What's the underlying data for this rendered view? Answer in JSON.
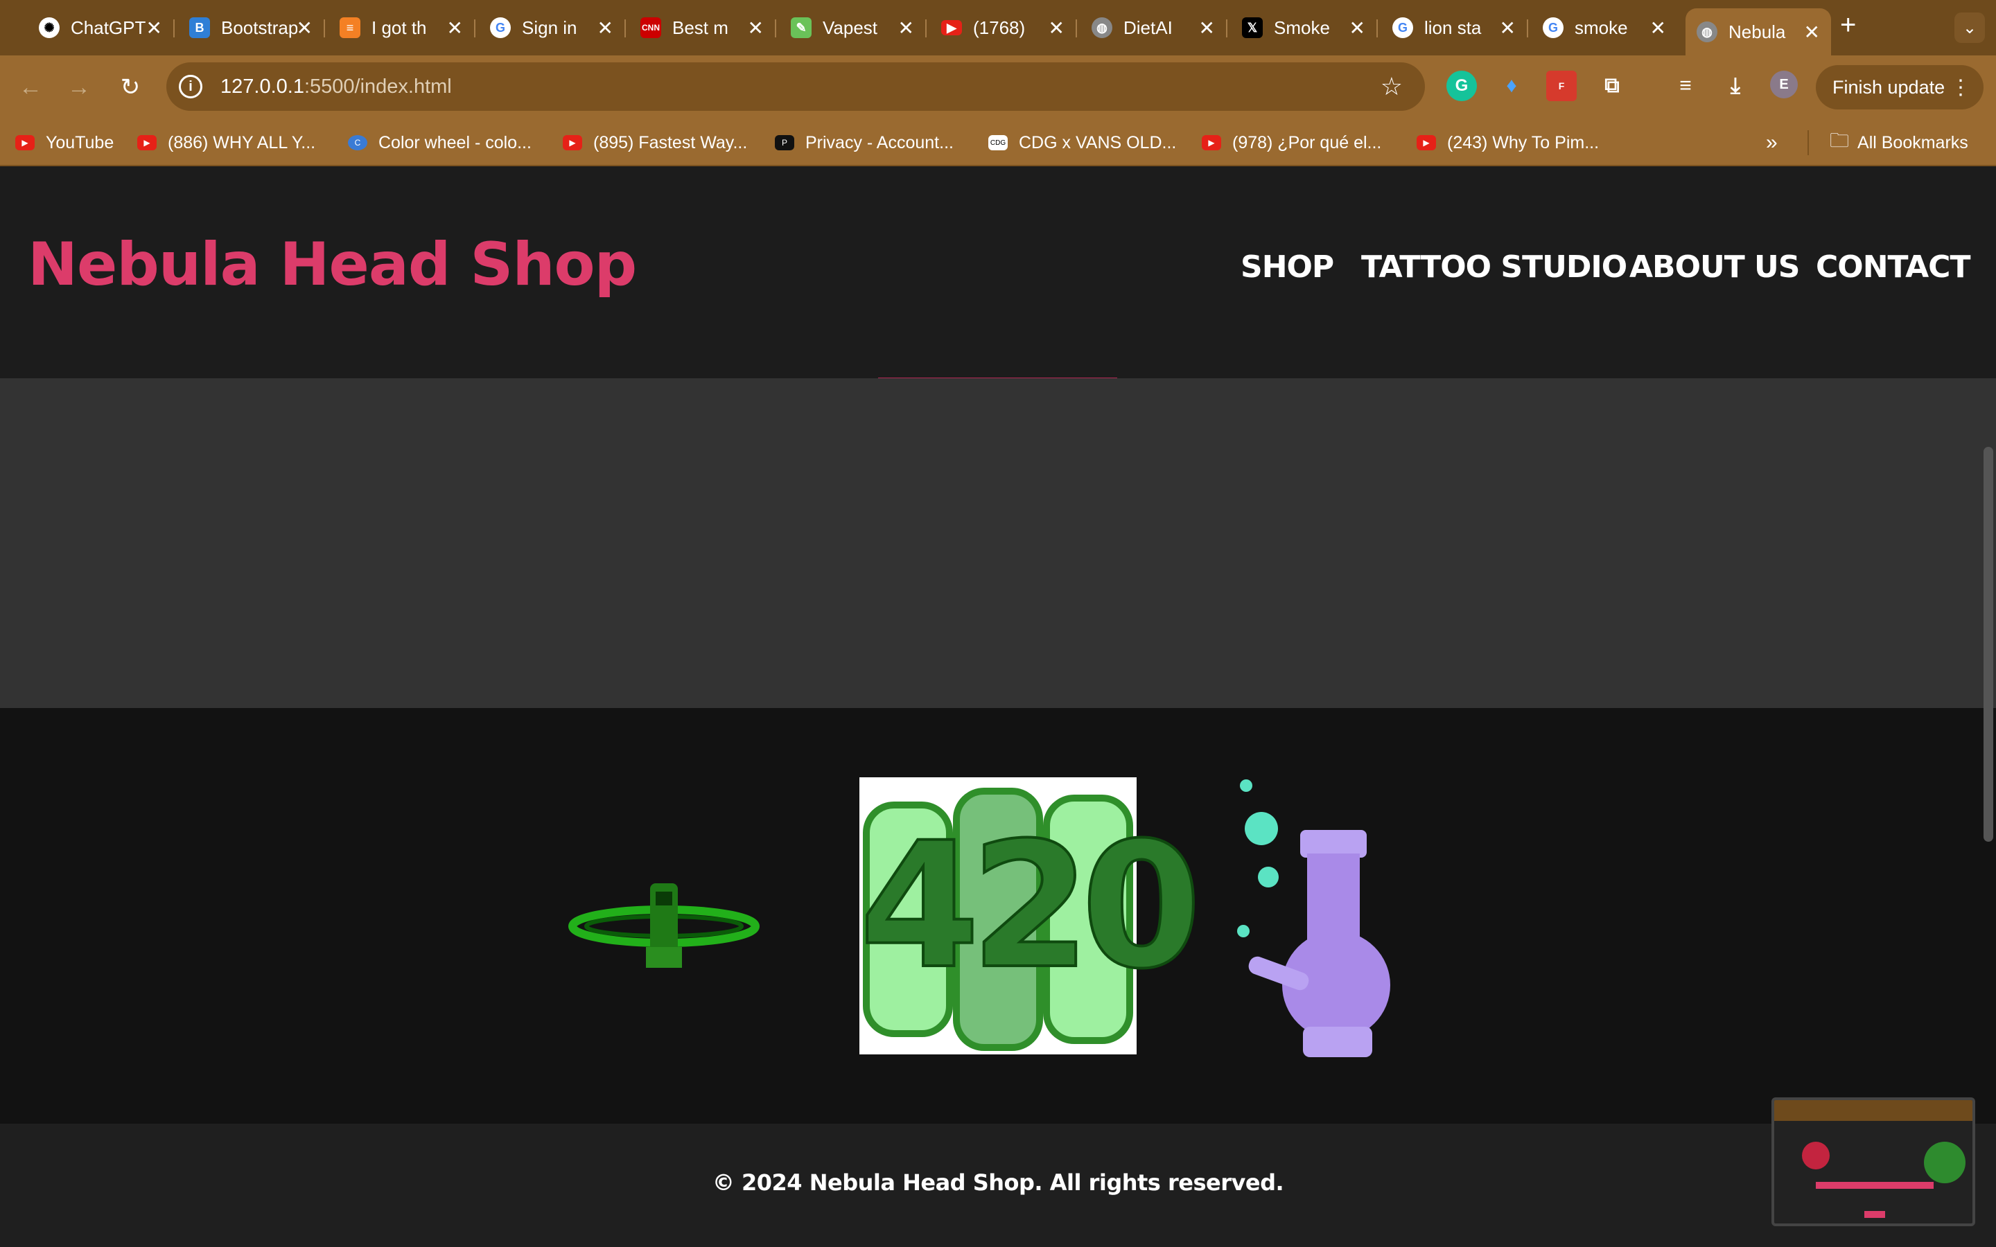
{
  "browser": {
    "tabs": [
      {
        "title": "ChatGPT",
        "icon": "chatgpt-icon"
      },
      {
        "title": "Bootstrap",
        "icon": "bootstrap-icon"
      },
      {
        "title": "I got th",
        "icon": "stackoverflow-icon"
      },
      {
        "title": "Sign in",
        "icon": "google-icon"
      },
      {
        "title": "Best m",
        "icon": "cnn-icon"
      },
      {
        "title": "Vapest",
        "icon": "vapestore-icon"
      },
      {
        "title": "(1768)",
        "icon": "youtube-icon"
      },
      {
        "title": "DietAI",
        "icon": "globe-icon"
      },
      {
        "title": "Smoke",
        "icon": "x-icon"
      },
      {
        "title": "lion sta",
        "icon": "google-icon"
      },
      {
        "title": "smoke",
        "icon": "google-icon"
      },
      {
        "title": "Nebula",
        "icon": "globe-icon"
      }
    ],
    "url_host": "127.0.0.1",
    "url_rest": ":5500/index.html",
    "finish_update": "Finish update",
    "profile_initial": "E",
    "bookmarks": [
      {
        "label": "YouTube"
      },
      {
        "label": "(886) WHY ALL Y..."
      },
      {
        "label": "Color wheel - colo..."
      },
      {
        "label": "(895) Fastest Way..."
      },
      {
        "label": "Privacy - Account..."
      },
      {
        "label": "CDG x VANS OLD..."
      },
      {
        "label": "(978) ¿Por qué el..."
      },
      {
        "label": "(243) Why To Pim..."
      }
    ],
    "all_bookmarks": "All Bookmarks"
  },
  "site": {
    "logo": "Nebula Head Shop",
    "nav": [
      "SHOP",
      "TATTOO STUDIO",
      "ABOUT US",
      "CONTACT"
    ],
    "gallery_center_text": "420",
    "copyright": "© 2024 Nebula Head Shop. All rights reserved."
  },
  "colors": {
    "brand": "#dc3c6a",
    "tabstrip": "#6e4a1c",
    "toolbar": "#9a6a30"
  }
}
